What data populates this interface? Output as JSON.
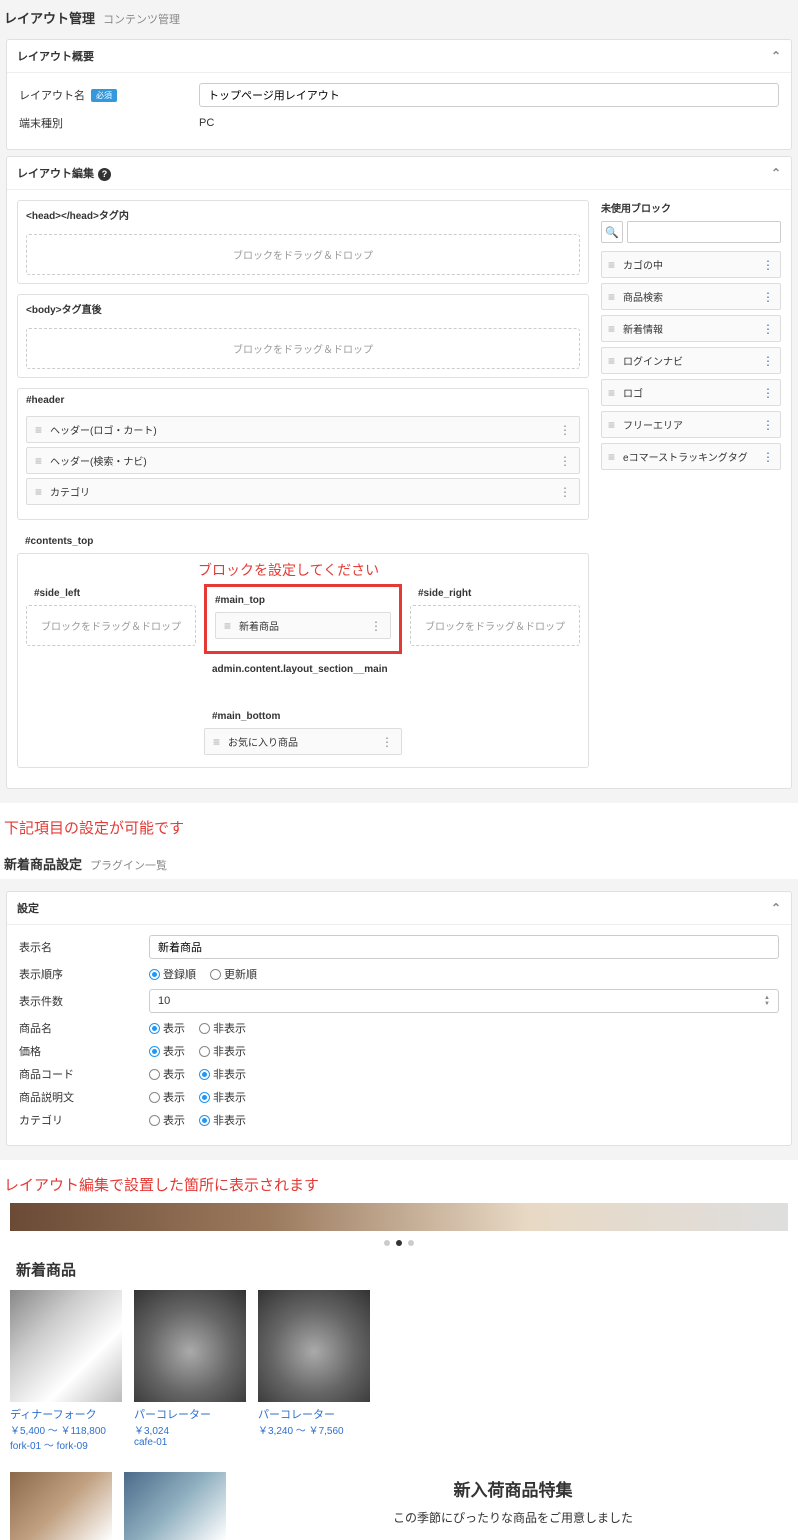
{
  "layout_mgmt": {
    "title": "レイアウト管理",
    "subtitle": "コンテンツ管理",
    "overview": {
      "header": "レイアウト概要",
      "name_label": "レイアウト名",
      "required": "必須",
      "name_value": "トップページ用レイアウト",
      "device_label": "端末種別",
      "device_value": "PC"
    },
    "edit": {
      "header": "レイアウト編集",
      "head_section": "<head></head>タグ内",
      "body_section": "<body>タグ直後",
      "dropzone": "ブロックをドラッグ＆ドロップ",
      "header_section": "#header",
      "header_blocks": [
        "ヘッダー(ロゴ・カート)",
        "ヘッダー(検索・ナビ)",
        "カテゴリ"
      ],
      "contents_top": "#contents_top",
      "set_block_msg": "ブロックを設定してください",
      "side_left": "#side_left",
      "side_right": "#side_right",
      "main_top": "#main_top",
      "main_top_block": "新着商品",
      "main_section": "admin.content.layout_section__main",
      "main_bottom": "#main_bottom",
      "main_bottom_block": "お気に入り商品"
    },
    "unused": {
      "title": "未使用ブロック",
      "blocks": [
        "カゴの中",
        "商品検索",
        "新着情報",
        "ログインナビ",
        "ロゴ",
        "フリーエリア",
        "eコマーストラッキングタグ"
      ]
    }
  },
  "note1": "下記項目の設定が可能です",
  "settings": {
    "title": "新着商品設定",
    "subtitle": "プラグイン一覧",
    "header": "設定",
    "display_name_label": "表示名",
    "display_name_value": "新着商品",
    "order_label": "表示順序",
    "order_opts": [
      "登録順",
      "更新順"
    ],
    "count_label": "表示件数",
    "count_value": "10",
    "product_name_label": "商品名",
    "price_label": "価格",
    "code_label": "商品コード",
    "desc_label": "商品説明文",
    "category_label": "カテゴリ",
    "show": "表示",
    "hide": "非表示"
  },
  "note2": "レイアウト編集で設置した箇所に表示されます",
  "preview": {
    "section_title": "新着商品",
    "products": [
      {
        "name": "ディナーフォーク",
        "price": "￥5,400 ～ ￥118,800",
        "code": "fork-01 ～ fork-09"
      },
      {
        "name": "パーコレーター",
        "price": "￥3,024",
        "code": "cafe-01"
      },
      {
        "name": "パーコレーター",
        "price": "￥3,240 ～ ￥7,560",
        "code": ""
      }
    ],
    "feature_title": "新入荷商品特集",
    "feature_sub": "この季節にぴったりな商品をご用意しました"
  }
}
